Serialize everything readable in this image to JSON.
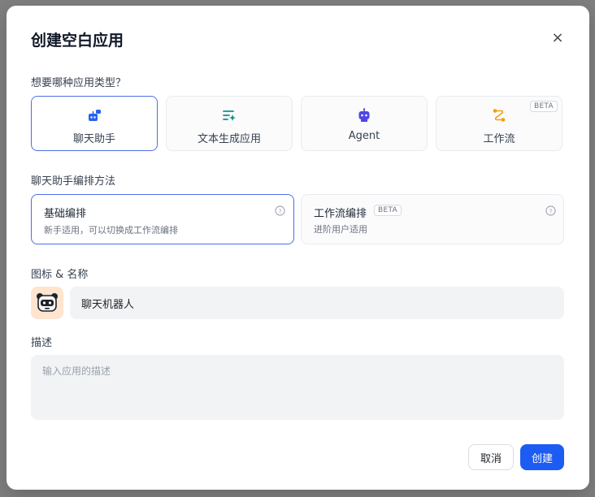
{
  "dialog": {
    "title": "创建空白应用",
    "close_symbol": "×"
  },
  "app_type": {
    "label": "想要哪种应用类型？",
    "options": [
      {
        "label": "聊天助手",
        "icon": "chat-bot-icon",
        "selected": true
      },
      {
        "label": "文本生成应用",
        "icon": "text-generation-icon",
        "selected": false
      },
      {
        "label": "Agent",
        "icon": "agent-robot-icon",
        "selected": false
      },
      {
        "label": "工作流",
        "icon": "workflow-icon",
        "selected": false,
        "badge": "BETA"
      }
    ]
  },
  "orchestration": {
    "label": "聊天助手编排方法",
    "options": [
      {
        "title": "基础编排",
        "desc": "新手适用，可以切换成工作流编排",
        "selected": true
      },
      {
        "title": "工作流编排",
        "desc": "进阶用户适用",
        "badge": "BETA",
        "selected": false
      }
    ]
  },
  "icon_name": {
    "label": "图标 & 名称",
    "avatar_icon": "panda-robot-icon",
    "name_value": "聊天机器人"
  },
  "description": {
    "label": "描述",
    "placeholder": "输入应用的描述"
  },
  "buttons": {
    "cancel": "取消",
    "create": "创建"
  },
  "colors": {
    "primary": "#1c5cf2",
    "selected_border": "#4e6ee6",
    "avatar_bg": "#ffe4cf",
    "input_bg": "#f2f3f5"
  }
}
